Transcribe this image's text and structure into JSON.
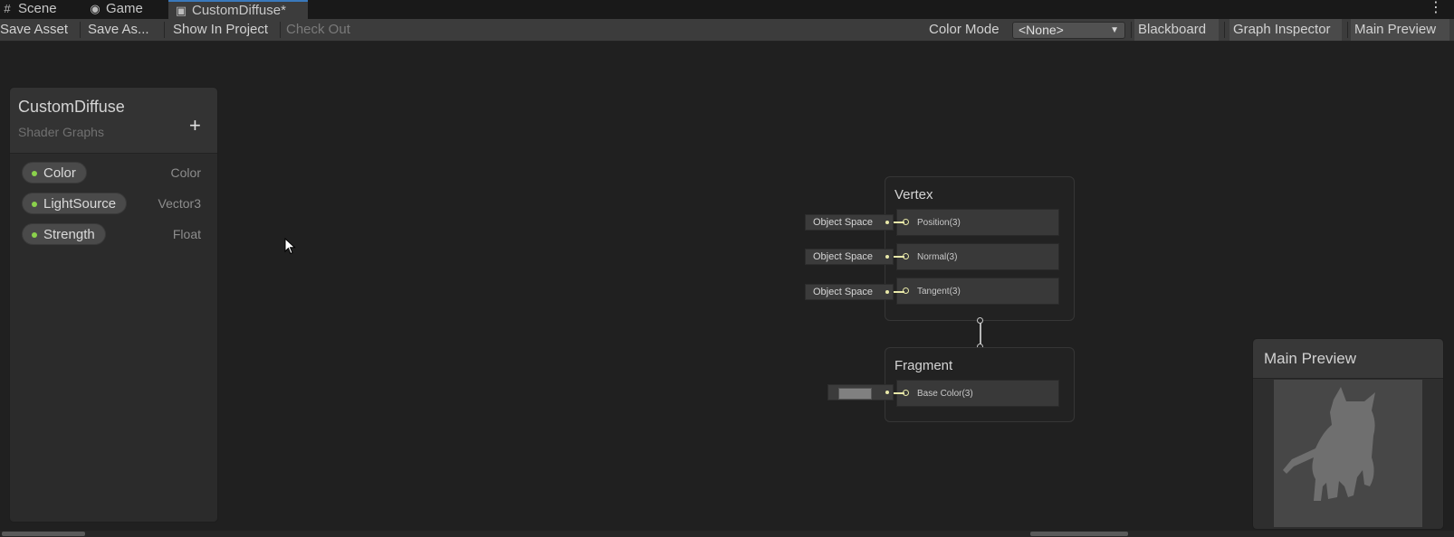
{
  "tabs": [
    {
      "label": "Scene",
      "icon": "grid-icon"
    },
    {
      "label": "Game",
      "icon": "gamepad-icon"
    },
    {
      "label": "CustomDiffuse*",
      "icon": "shadergraph-icon"
    }
  ],
  "toolbar": {
    "save_asset": "Save Asset",
    "save_as": "Save As...",
    "show_in_project": "Show In Project",
    "check_out": "Check Out",
    "color_mode_label": "Color Mode",
    "color_mode_value": "<None>",
    "blackboard": "Blackboard",
    "graph_inspector": "Graph Inspector",
    "main_preview": "Main Preview"
  },
  "blackboard": {
    "title": "CustomDiffuse",
    "subtitle": "Shader Graphs",
    "properties": [
      {
        "name": "Color",
        "type": "Color"
      },
      {
        "name": "LightSource",
        "type": "Vector3"
      },
      {
        "name": "Strength",
        "type": "Float"
      }
    ]
  },
  "vertex": {
    "title": "Vertex",
    "slots": [
      {
        "label": "Position(3)",
        "input": "Object Space"
      },
      {
        "label": "Normal(3)",
        "input": "Object Space"
      },
      {
        "label": "Tangent(3)",
        "input": "Object Space"
      }
    ]
  },
  "fragment": {
    "title": "Fragment",
    "slots": [
      {
        "label": "Base Color(3)",
        "color": "#808080"
      }
    ]
  },
  "preview": {
    "title": "Main Preview"
  },
  "colors": {
    "accent": "#3a79bb",
    "property_dot": "#8bd24c",
    "port": "#e8e8a8"
  }
}
